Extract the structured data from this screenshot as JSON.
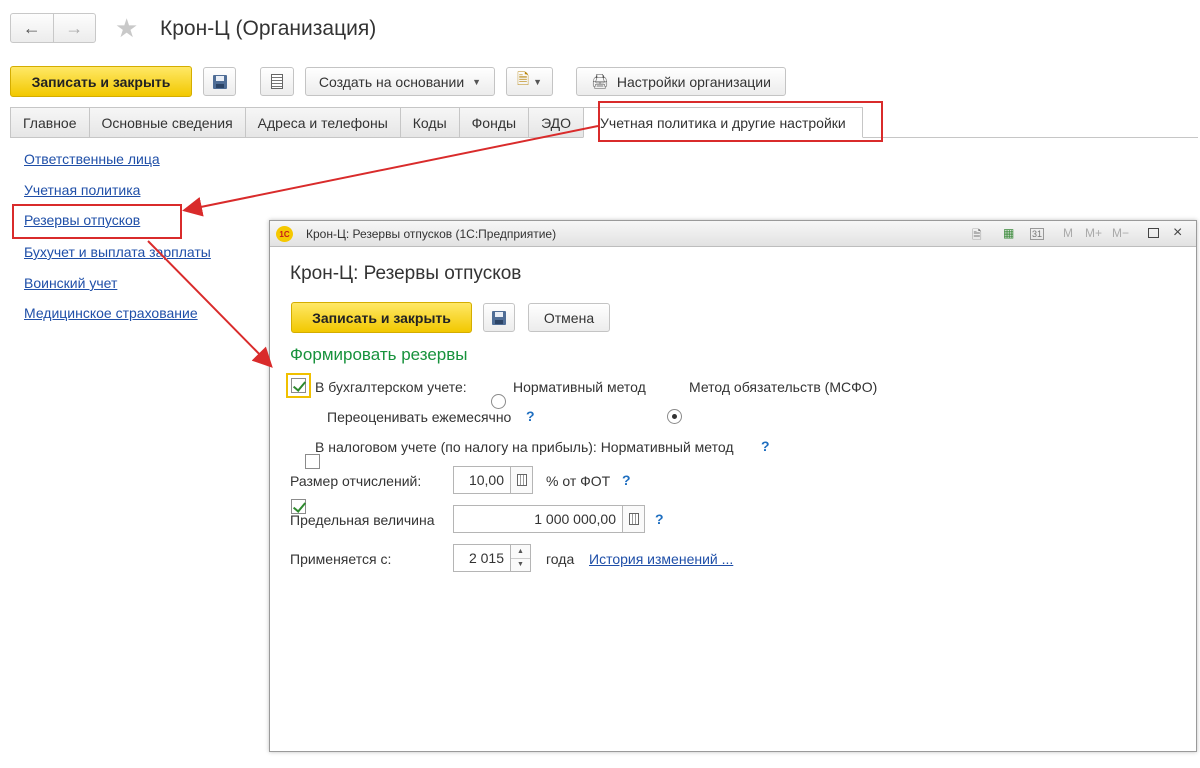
{
  "window": {
    "title": "Крон-Ц (Организация)"
  },
  "toolbar": {
    "save_close": "Записать и закрыть",
    "create_based_on": "Создать на основании",
    "org_settings": "Настройки организации"
  },
  "tabs": [
    {
      "label": "Главное"
    },
    {
      "label": "Основные сведения"
    },
    {
      "label": "Адреса и телефоны"
    },
    {
      "label": "Коды"
    },
    {
      "label": "Фонды"
    },
    {
      "label": "ЭДО"
    },
    {
      "label": "Учетная политика и другие настройки",
      "active": true
    }
  ],
  "left_links": [
    {
      "label": "Ответственные лица"
    },
    {
      "label": "Учетная политика"
    },
    {
      "label": "Резервы отпусков"
    },
    {
      "label": "Бухучет и выплата зарплаты"
    },
    {
      "label": "Воинский учет"
    },
    {
      "label": "Медицинское страхование"
    }
  ],
  "dialog": {
    "window_title": "Крон-Ц: Резервы отпусков  (1С:Предприятие)",
    "logo_text": "1С",
    "titlebar_buttons": [
      "M",
      "M+",
      "M−"
    ],
    "heading": "Крон-Ц: Резервы отпусков",
    "save_close": "Записать и закрыть",
    "cancel": "Отмена",
    "section_title": "Формировать резервы",
    "accounting_label": "В бухгалтерском учете:",
    "accounting_checked": true,
    "method_normative": "Нормативный метод",
    "method_ifrs": "Метод обязательств (МСФО)",
    "selected_method": "Метод обязательств (МСФО)",
    "revalue_label": "Переоценивать ежемесячно",
    "revalue_checked": false,
    "tax_label": "В налоговом учете (по налогу на прибыль): Нормативный метод",
    "tax_checked": true,
    "help": "?",
    "rate_label": "Размер отчислений:",
    "rate_value": "10,00",
    "rate_unit": "% от ФОТ",
    "limit_label": "Предельная величина",
    "limit_value": "1 000 000,00",
    "applies_label": "Применяется с:",
    "applies_year": "2 015",
    "applies_unit": "года",
    "history_link": "История изменений ..."
  }
}
